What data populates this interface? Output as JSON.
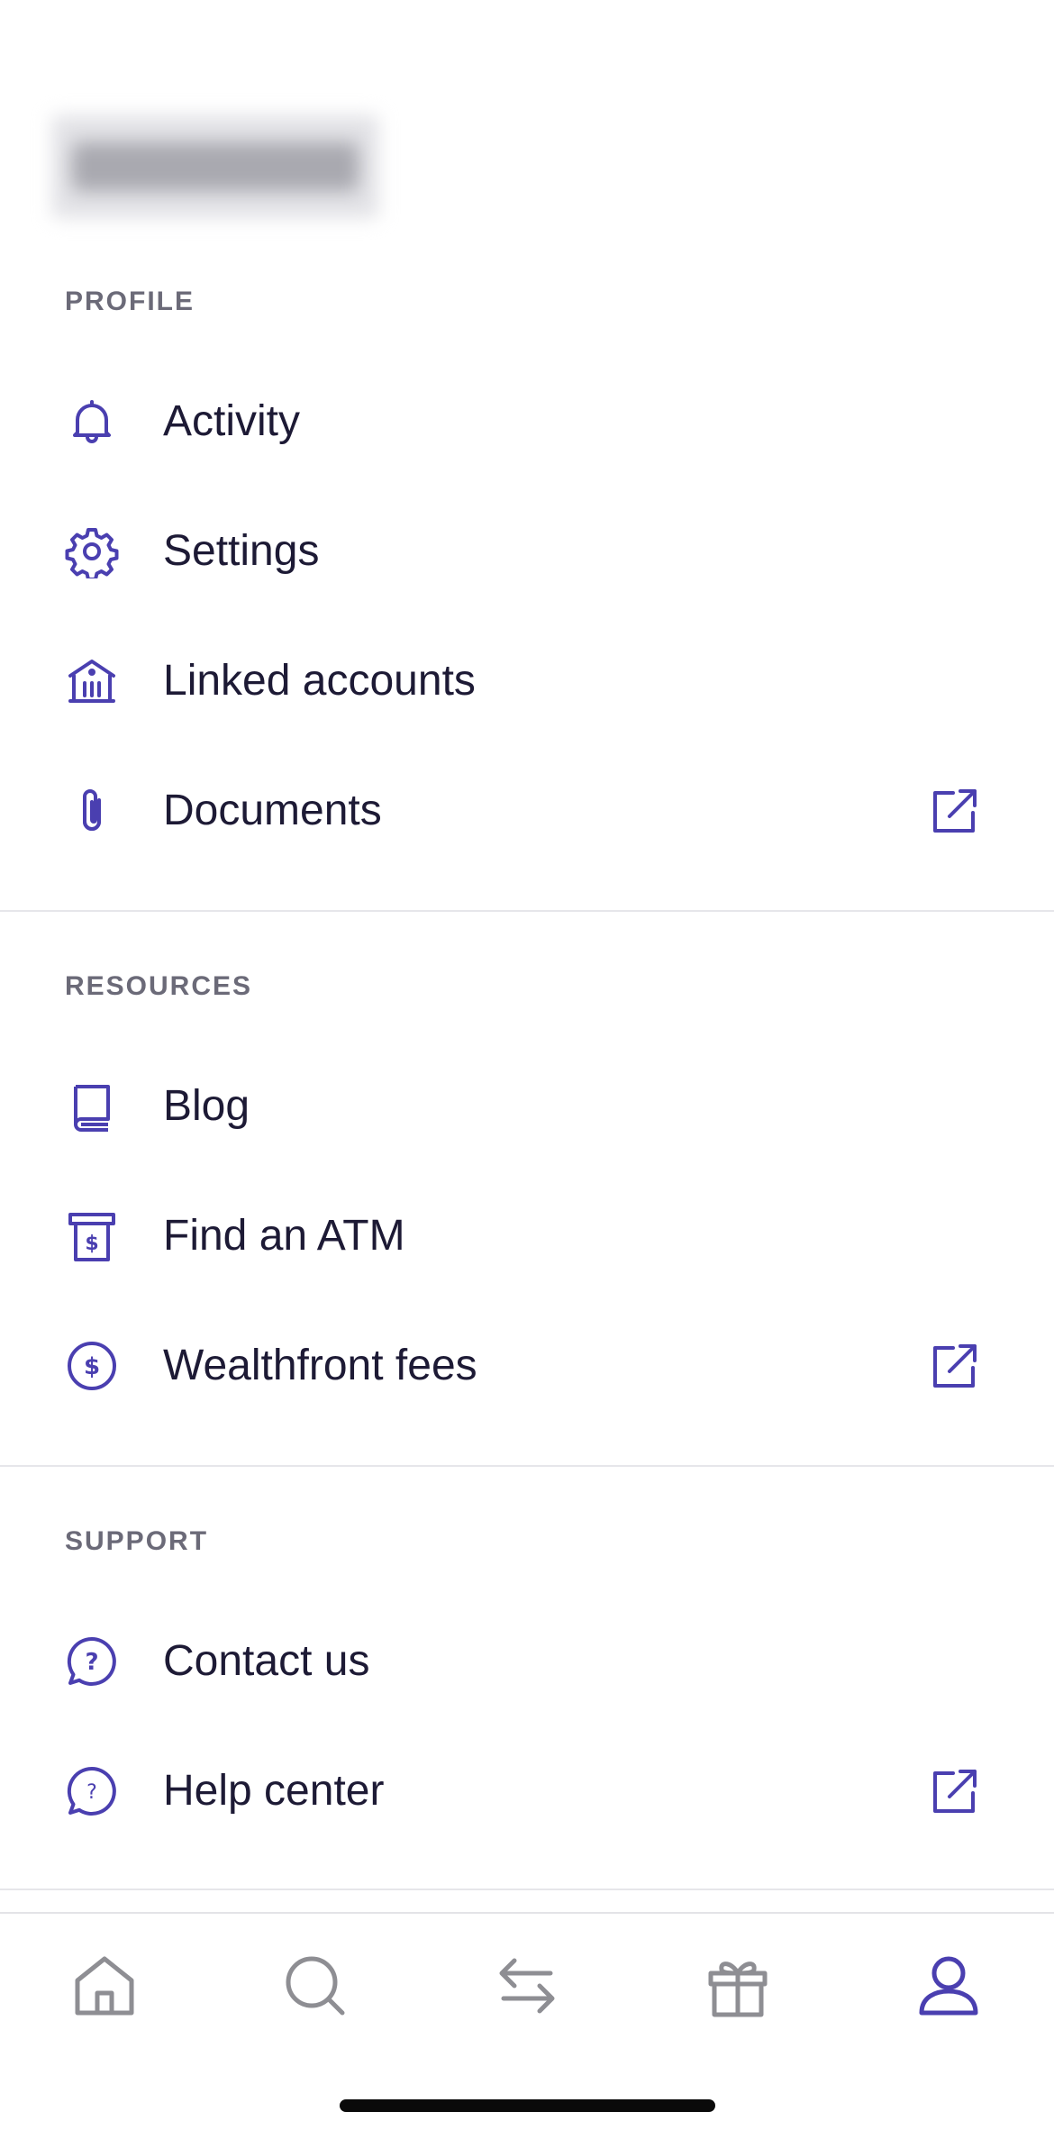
{
  "profile": {
    "section_label": "PROFILE",
    "items": [
      {
        "label": "Activity",
        "icon": "bell-icon",
        "external": false
      },
      {
        "label": "Settings",
        "icon": "gear-icon",
        "external": false
      },
      {
        "label": "Linked accounts",
        "icon": "bank-icon",
        "external": false
      },
      {
        "label": "Documents",
        "icon": "paperclip-icon",
        "external": true
      }
    ]
  },
  "resources": {
    "section_label": "RESOURCES",
    "items": [
      {
        "label": "Blog",
        "icon": "book-icon",
        "external": false
      },
      {
        "label": "Find an ATM",
        "icon": "atm-icon",
        "external": false
      },
      {
        "label": "Wealthfront fees",
        "icon": "dollar-circle-icon",
        "external": true
      }
    ]
  },
  "support": {
    "section_label": "SUPPORT",
    "items": [
      {
        "label": "Contact us",
        "icon": "question-chat-icon",
        "external": false
      },
      {
        "label": "Help center",
        "icon": "question-chat-icon",
        "external": true
      }
    ]
  },
  "tab_bar": {
    "tabs": [
      {
        "name": "home",
        "icon": "home-icon",
        "active": false
      },
      {
        "name": "search",
        "icon": "search-icon",
        "active": false
      },
      {
        "name": "transfer",
        "icon": "transfer-arrows-icon",
        "active": false
      },
      {
        "name": "rewards",
        "icon": "gift-icon",
        "active": false
      },
      {
        "name": "profile",
        "icon": "person-icon",
        "active": true
      }
    ]
  },
  "colors": {
    "accent": "#4a3fb0",
    "text": "#1d1a35",
    "section_label": "#6b6a78",
    "inactive_tab": "#8e8e93",
    "divider": "#e6e6ea"
  }
}
